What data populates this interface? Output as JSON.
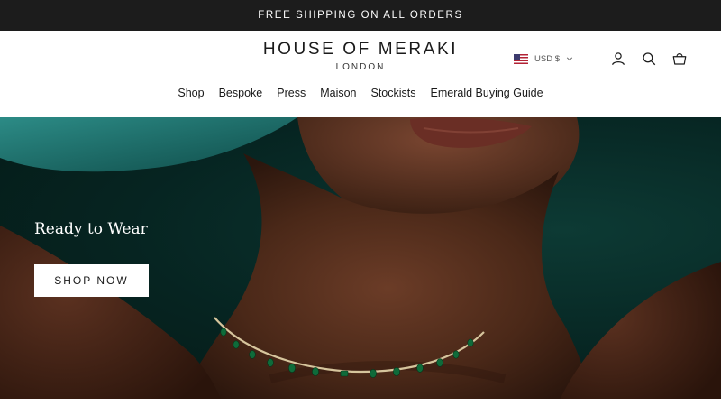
{
  "announcement": {
    "text": "FREE SHIPPING ON ALL ORDERS"
  },
  "brand": {
    "name": "HOUSE OF MERAKI",
    "location": "LONDON"
  },
  "utility": {
    "currency_label": "USD $",
    "icons": [
      "flag-us-icon",
      "chevron-down-icon",
      "account-icon",
      "search-icon",
      "cart-icon"
    ]
  },
  "nav": {
    "items": [
      {
        "label": "Shop"
      },
      {
        "label": "Bespoke"
      },
      {
        "label": "Press"
      },
      {
        "label": "Maison"
      },
      {
        "label": "Stockists"
      },
      {
        "label": "Emerald Buying Guide"
      }
    ]
  },
  "hero": {
    "title": "Ready to Wear",
    "cta_label": "SHOP NOW"
  },
  "colors": {
    "announcement_bg": "#1c1c1c",
    "hero_bg": "#062421",
    "skin": "#5a3322",
    "emerald": "#0f6b3a",
    "gold": "#c9b48a"
  }
}
